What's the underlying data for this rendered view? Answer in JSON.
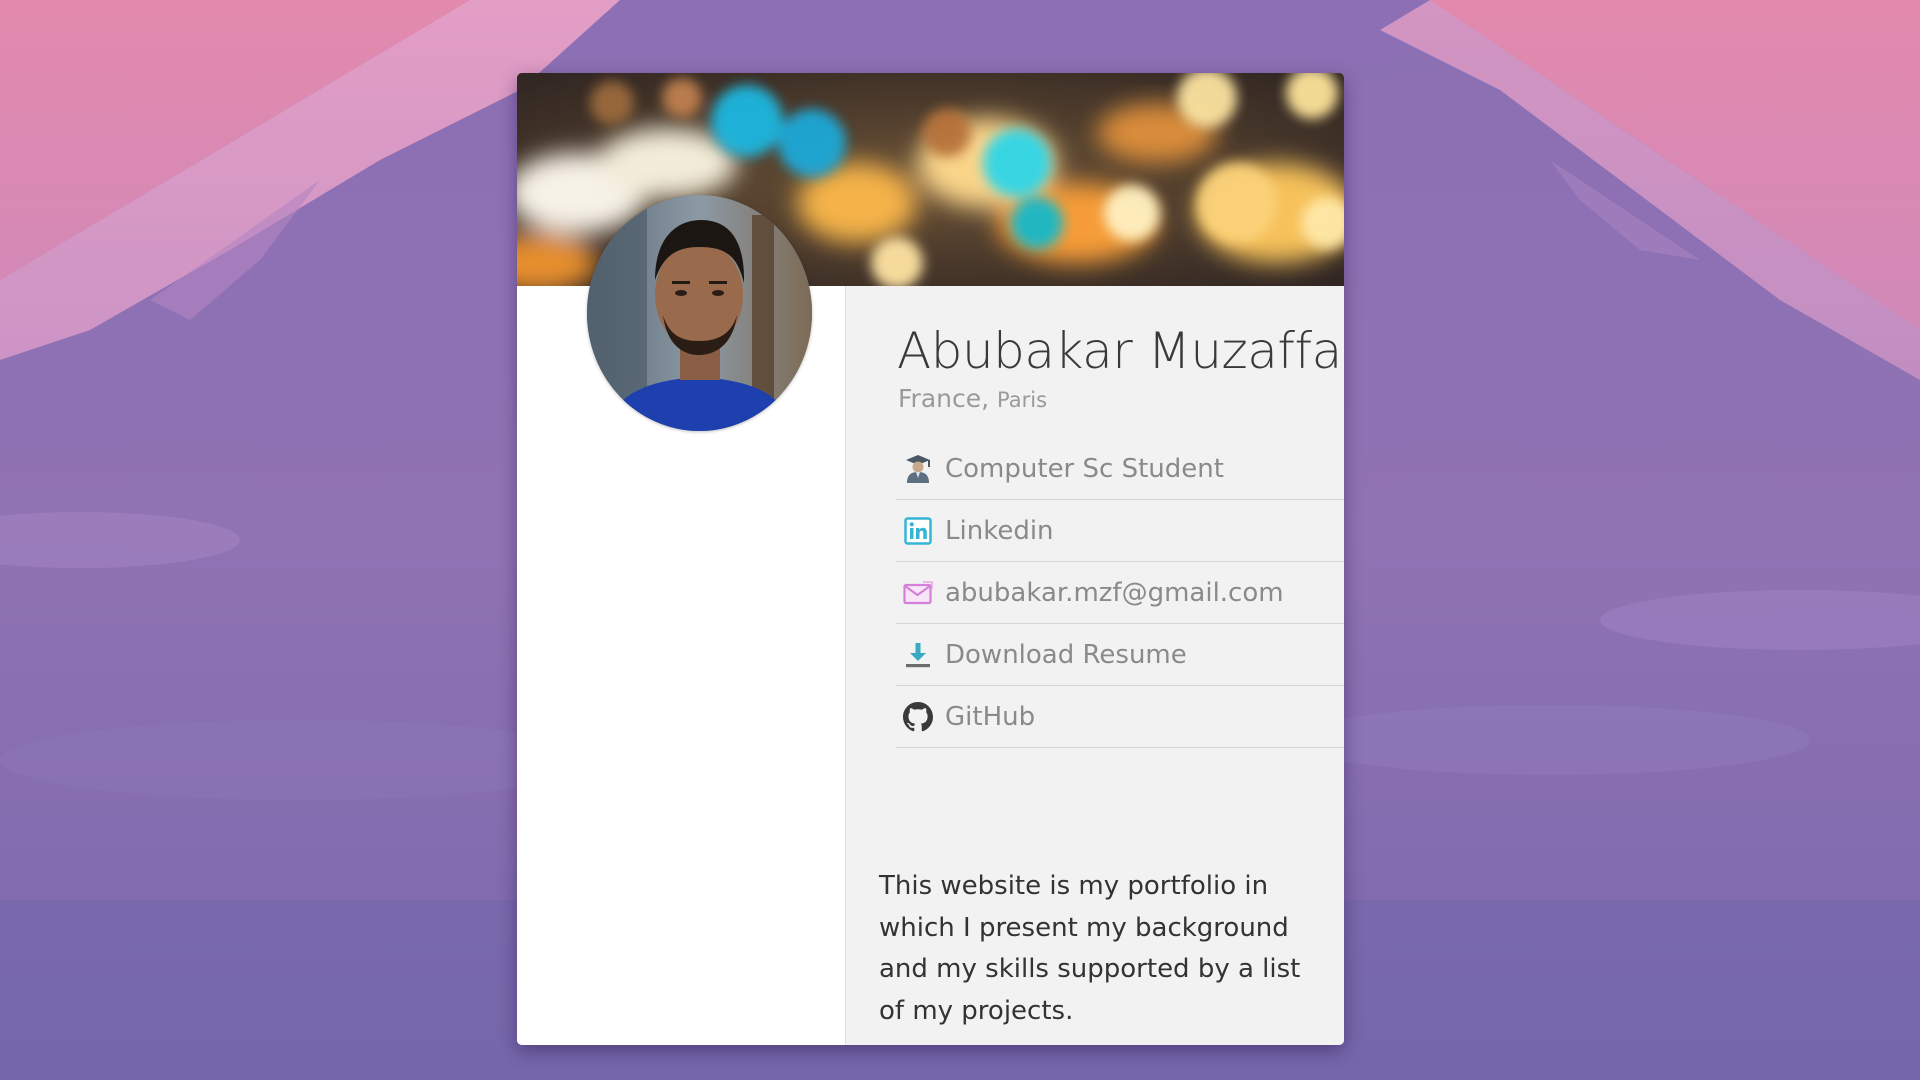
{
  "profile": {
    "name": "Abubakar Muzaffar",
    "country": "France,",
    "city": "Paris"
  },
  "links": [
    {
      "icon": "student-icon",
      "label": "Computer Sc Student"
    },
    {
      "icon": "linkedin-icon",
      "label": "Linkedin"
    },
    {
      "icon": "mail-icon",
      "label": "abubakar.mzf@gmail.com"
    },
    {
      "icon": "download-icon",
      "label": "Download Resume"
    },
    {
      "icon": "github-icon",
      "label": "GitHub"
    }
  ],
  "bio": "This website is my portfolio in which I present my background and my skills supported by a list of my projects.",
  "colors": {
    "card_background": "#ffffff",
    "panel_background": "#f2f2f2",
    "name_text": "#3a3a3a",
    "link_text": "#8a8a8a",
    "linkedin_accent": "#35b5d6",
    "mail_accent": "#d77fd8",
    "download_accent": "#3aa9c2"
  }
}
